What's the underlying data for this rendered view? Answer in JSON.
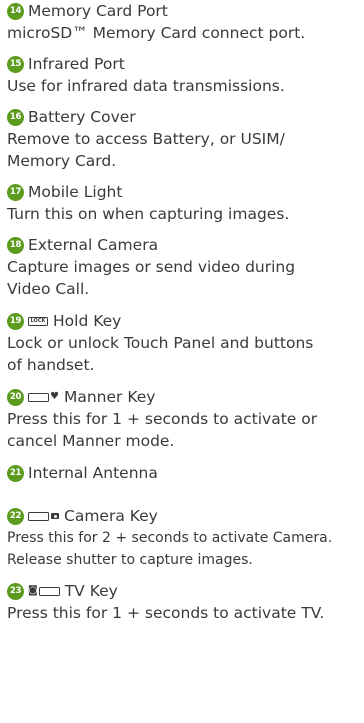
{
  "accent_color": "#5d9b1e",
  "items": [
    {
      "number": "14",
      "title": "Memory Card Port",
      "lines": [
        "microSD™ Memory Card connect port."
      ]
    },
    {
      "number": "15",
      "title": "Infrared Port",
      "lines": [
        "Use for infrared data transmissions."
      ]
    },
    {
      "number": "16",
      "title": "Battery Cover",
      "lines": [
        "Remove to access Battery, or USIM/",
        "Memory Card."
      ]
    },
    {
      "number": "17",
      "title": "Mobile Light",
      "lines": [
        "Turn this on when capturing images."
      ]
    },
    {
      "number": "18",
      "title": "External Camera",
      "lines": [
        "Capture images or send video during",
        "Video Call."
      ]
    },
    {
      "number": "19",
      "title": "Hold Key",
      "icon": "lock-key-icon",
      "icon_text": "LOCK",
      "lines": [
        "Lock or unlock Touch Panel and buttons",
        "of handset."
      ]
    },
    {
      "number": "20",
      "title": "Manner Key",
      "icon": "manner-key-icon",
      "lines": [
        "Press this for 1 + seconds to activate or",
        "cancel Manner mode."
      ]
    },
    {
      "number": "21",
      "title": "Internal Antenna",
      "lines": []
    },
    {
      "number": "22",
      "title": "Camera Key",
      "icon": "camera-key-icon",
      "lines": [
        "Press this for 2 + seconds to activate Camera.",
        "Release shutter to capture images."
      ]
    },
    {
      "number": "23",
      "title": "TV Key",
      "icon": "tv-key-icon",
      "lines": [
        "Press this for 1 + seconds to activate TV."
      ]
    }
  ]
}
